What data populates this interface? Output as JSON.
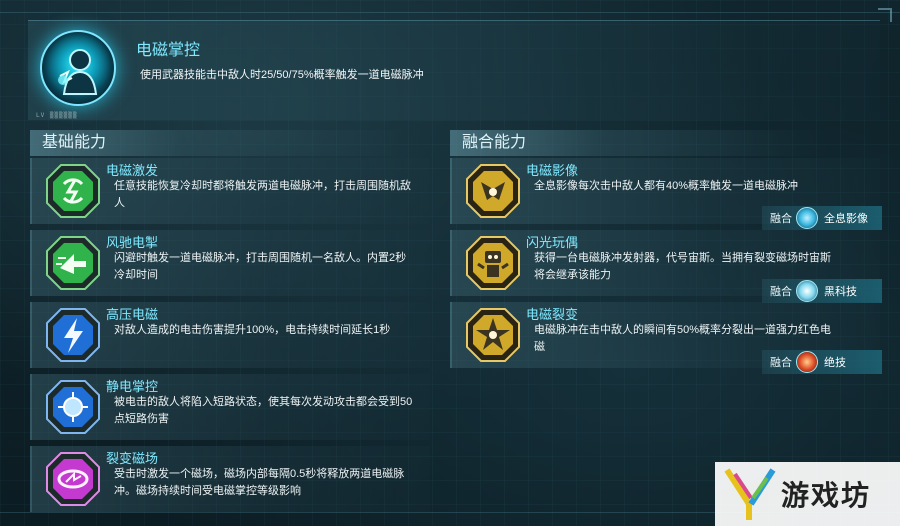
{
  "hero": {
    "title": "电磁掌控",
    "description": "使用武器技能击中敌人时25/50/75%概率触发一道电磁脉冲",
    "badge_icon": "electro-hero-icon",
    "caption": "LV ▒▒▒▒▒▒"
  },
  "sections": {
    "basic": {
      "title": "基础能力"
    },
    "fusion": {
      "title": "融合能力"
    }
  },
  "basic_skills": [
    {
      "name": "电磁激发",
      "desc": "任意技能恢复冷却时都将触发两道电磁脉冲，打击周围随机敌人",
      "icon": "lightning-swirl-icon",
      "color": "#2fb34a"
    },
    {
      "name": "风驰电掣",
      "desc": "闪避时触发一道电磁脉冲，打击周围随机一名敌人。内置2秒冷却时间",
      "icon": "dash-arrow-icon",
      "color": "#2fb34a"
    },
    {
      "name": "高压电磁",
      "desc": "对敌人造成的电击伤害提升100%，电击持续时间延长1秒",
      "icon": "lightning-bolt-icon",
      "color": "#1f6fd6"
    },
    {
      "name": "静电掌控",
      "desc": "被电击的敌人将陷入短路状态，使其每次发动攻击都会受到50点短路伤害",
      "icon": "electric-orb-icon",
      "color": "#1f6fd6"
    },
    {
      "name": "裂变磁场",
      "desc": "受击时激发一个磁场，磁场内部每隔0.5秒将释放两道电磁脉冲。磁场持续时间受电磁掌控等级影响",
      "icon": "magnetic-field-icon",
      "color": "#c43ad0"
    }
  ],
  "fusion_skills": [
    {
      "name": "电磁影像",
      "desc": "全息影像每次击中敌人都有40%概率触发一道电磁脉冲",
      "icon": "hologram-icon",
      "color": "#d0a82a",
      "tag": {
        "label": "融合",
        "name": "全息影像",
        "icon": "hologram-ball-icon",
        "ball_color": "#3ab7e0"
      }
    },
    {
      "name": "闪光玩偶",
      "desc": "获得一台电磁脉冲发射器，代号宙斯。当拥有裂变磁场时宙斯将会继承该能力",
      "icon": "robot-doll-icon",
      "color": "#d0a82a",
      "tag": {
        "label": "融合",
        "name": "黑科技",
        "icon": "tech-ball-icon",
        "ball_color": "#7fd7ef"
      }
    },
    {
      "name": "电磁裂变",
      "desc": "电磁脉冲在击中敌人的瞬间有50%概率分裂出一道强力红色电磁",
      "icon": "fission-star-icon",
      "color": "#d0a82a",
      "tag": {
        "label": "融合",
        "name": "绝技",
        "icon": "fire-ball-icon",
        "ball_color": "#e0502a"
      }
    }
  ],
  "watermark": {
    "text": "游戏坊"
  }
}
